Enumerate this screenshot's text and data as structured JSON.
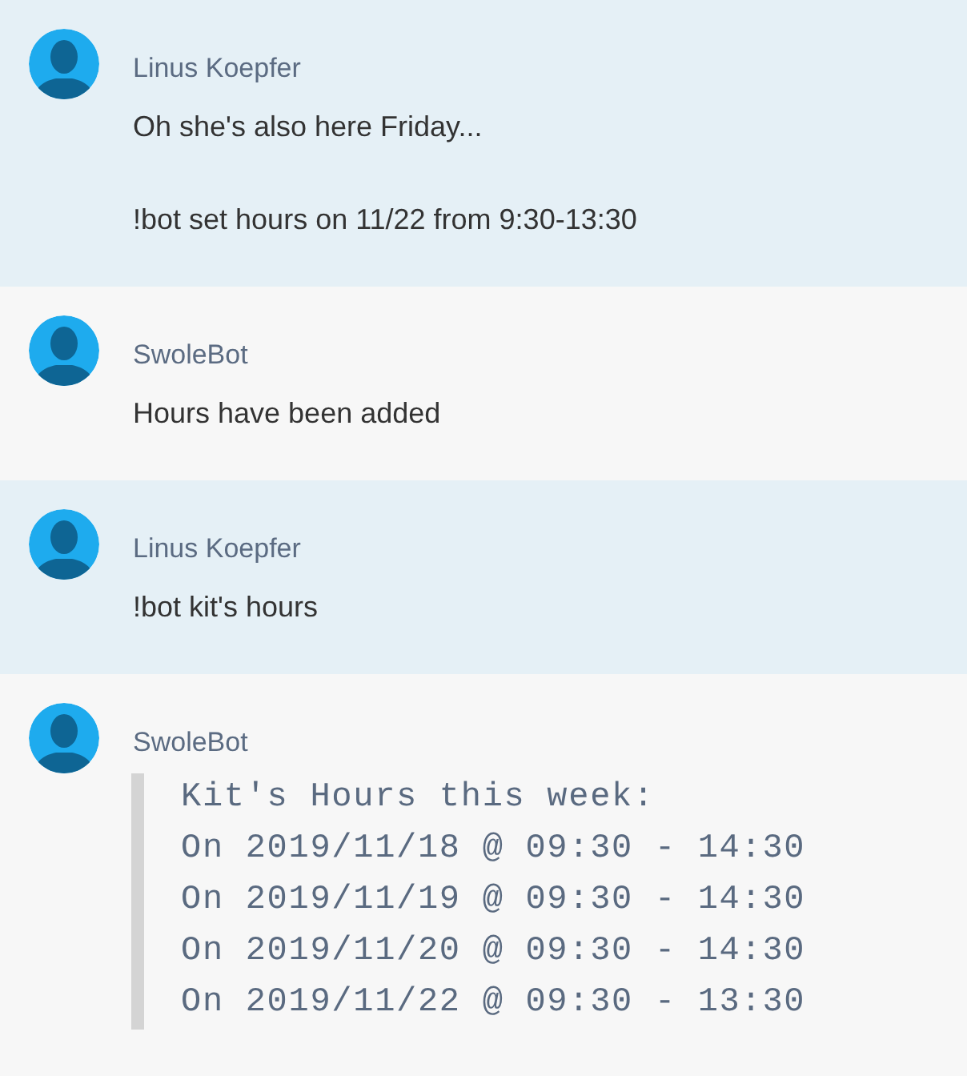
{
  "messages": [
    {
      "sender": "Linus Koepfer",
      "from_bot": false,
      "kind": "text",
      "paragraphs": [
        "Oh she's also here Friday...",
        "!bot set hours on 11/22 from 9:30-13:30"
      ]
    },
    {
      "sender": "SwoleBot",
      "from_bot": true,
      "kind": "text",
      "paragraphs": [
        "Hours have been added"
      ]
    },
    {
      "sender": "Linus Koepfer",
      "from_bot": false,
      "kind": "text",
      "paragraphs": [
        "!bot kit's hours"
      ]
    },
    {
      "sender": "SwoleBot",
      "from_bot": true,
      "kind": "code_quote",
      "lines": [
        "Kit's Hours this week:",
        "On 2019/11/18 @ 09:30 - 14:30",
        "On 2019/11/19 @ 09:30 - 14:30",
        "On 2019/11/20 @ 09:30 - 14:30",
        "On 2019/11/22 @ 09:30 - 13:30"
      ]
    }
  ]
}
